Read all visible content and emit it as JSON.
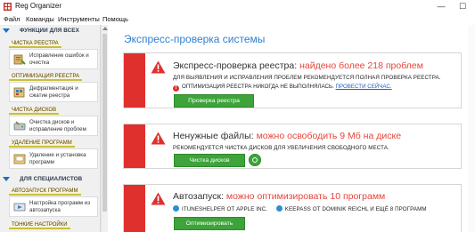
{
  "window": {
    "title": "Reg Organizer",
    "controls": {
      "minimize": "—",
      "maximize": "☐"
    }
  },
  "menu": [
    "Файл",
    "Команды",
    "Инструменты",
    "Помощь"
  ],
  "sidebar": {
    "section_all": "ФУНКЦИИ ДЛЯ ВСЕХ",
    "section_pro": "ДЛЯ СПЕЦИАЛИСТОВ",
    "items": [
      {
        "tab": "ЧИСТКА РЕЕСТРА",
        "label": "Исправление ошибок и очистка"
      },
      {
        "tab": "ОПТИМИЗАЦИЯ РЕЕСТРА",
        "label": "Дефрагментация и сжатие реестра"
      },
      {
        "tab": "ЧИСТКА ДИСКОВ",
        "label": "Очистка дисков и исправление проблем"
      },
      {
        "tab": "УДАЛЕНИЕ ПРОГРАММ",
        "label": "Удаление и установка программ"
      }
    ],
    "pro_items": [
      {
        "tab": "АВТОЗАПУСК ПРОГРАММ",
        "label": "Настройка программ из автозапуска"
      },
      {
        "tab": "ТОНКИЕ НАСТРОЙКИ",
        "label": ""
      }
    ]
  },
  "main": {
    "title": "Экспресс-проверка системы",
    "cards": [
      {
        "heading": "Экспресс-проверка реестра: ",
        "accent": "найдено более 218 проблем",
        "sub": "ДЛЯ ВЫЯВЛЕНИЯ И ИСПРАВЛЕНИЯ ПРОБЛЕМ РЕКОМЕНДУЕТСЯ ПОЛНАЯ ПРОВЕРКА РЕЕСТРА.",
        "error_text": "ОПТИМИЗАЦИЯ РЕЕСТРА НИКОГДА НЕ ВЫПОЛНЯЛАСЬ. ",
        "error_link": "ПРОВЕСТИ СЕЙЧАС.",
        "button": "Проверка реестра"
      },
      {
        "heading": "Ненужные файлы: ",
        "accent": "можно освободить 9 Мб на диске",
        "sub": "РЕКОМЕНДУЕТСЯ ЧИСТКА ДИСКОВ ДЛЯ УВЕЛИЧЕНИЯ СВОБОДНОГО МЕСТА.",
        "button": "Чистка дисков"
      },
      {
        "heading": "Автозапуск: ",
        "accent": "можно оптимизировать 10 программ",
        "sub_a": "ITUNESHELPER ОТ APPLE INC.",
        "sub_b": "KEEPASS ОТ DOMINIK REICHL И ЕЩЁ 8 ПРОГРАММ",
        "button": "Оптимизировать"
      }
    ]
  },
  "colors": {
    "accent_red": "#e0302e",
    "accent_text": "#e8443a",
    "title_blue": "#2f7fd0",
    "button_green": "#3ea33a",
    "tab_underline": "#c9bf3a"
  }
}
